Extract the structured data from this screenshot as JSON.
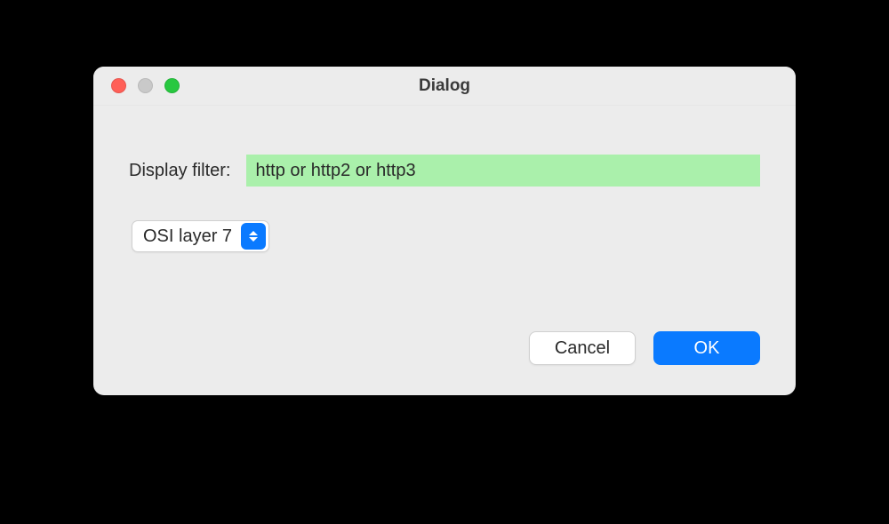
{
  "window": {
    "title": "Dialog"
  },
  "filter": {
    "label": "Display filter:",
    "value": "http or http2 or http3"
  },
  "select": {
    "value": "OSI layer 7"
  },
  "buttons": {
    "cancel": "Cancel",
    "ok": "OK"
  }
}
